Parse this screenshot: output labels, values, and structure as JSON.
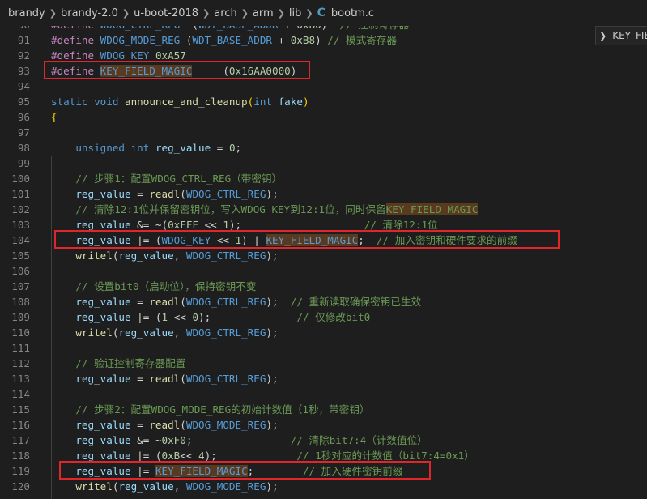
{
  "breadcrumb": {
    "segments": [
      "brandy",
      "brandy-2.0",
      "u-boot-2018",
      "arch",
      "arm",
      "lib"
    ],
    "file_icon": "C",
    "file_name": "bootm.c"
  },
  "outline": {
    "label": "KEY_FIE"
  },
  "highlight_color": "#e0262b",
  "lines": [
    {
      "n": "90",
      "t": [
        [
          "pp",
          "#define "
        ],
        [
          "mac",
          "WDOG_CTRL_REG"
        ],
        [
          "",
          "  ("
        ],
        [
          "mac",
          "WDT_BASE_ADDR"
        ],
        [
          "",
          " + "
        ],
        [
          "num",
          "0xB0"
        ],
        [
          "",
          ")  "
        ],
        [
          "cm",
          "// 控制寄存器"
        ]
      ]
    },
    {
      "n": "91",
      "t": [
        [
          "pp",
          "#define "
        ],
        [
          "mac",
          "WDOG_MODE_REG"
        ],
        [
          "",
          " ("
        ],
        [
          "mac",
          "WDT_BASE_ADDR"
        ],
        [
          "",
          " + "
        ],
        [
          "num",
          "0xB8"
        ],
        [
          "",
          ") "
        ],
        [
          "cm",
          "// 模式寄存器"
        ]
      ]
    },
    {
      "n": "92",
      "t": [
        [
          "pp",
          "#define "
        ],
        [
          "mac",
          "WDOG_KEY"
        ],
        [
          "",
          " "
        ],
        [
          "num",
          "0xA57"
        ]
      ]
    },
    {
      "n": "93",
      "t": [
        [
          "pp",
          "#define "
        ],
        [
          "mac hl",
          "KEY_FIELD_MAGIC"
        ],
        [
          "",
          "     ("
        ],
        [
          "num",
          "0x16AA0000"
        ],
        [
          "",
          ")"
        ]
      ]
    },
    {
      "n": "94",
      "t": []
    },
    {
      "n": "95",
      "t": [
        [
          "kw",
          "static "
        ],
        [
          "kw",
          "void "
        ],
        [
          "fn",
          "announce_and_cleanup"
        ],
        [
          "br",
          "("
        ],
        [
          "kw",
          "int "
        ],
        [
          "var",
          "fake"
        ],
        [
          "br",
          ")"
        ]
      ]
    },
    {
      "n": "96",
      "t": [
        [
          "br",
          "{"
        ]
      ]
    },
    {
      "n": "97",
      "t": []
    },
    {
      "n": "98",
      "t": [
        [
          "",
          "    "
        ],
        [
          "kw",
          "unsigned "
        ],
        [
          "kw",
          "int "
        ],
        [
          "var",
          "reg_value"
        ],
        [
          "",
          " = "
        ],
        [
          "num",
          "0"
        ],
        [
          "",
          ";"
        ]
      ]
    },
    {
      "n": "99",
      "t": []
    },
    {
      "n": "100",
      "t": [
        [
          "",
          "    "
        ],
        [
          "cm",
          "// 步骤1：配置WDOG_CTRL_REG（带密钥）"
        ]
      ]
    },
    {
      "n": "101",
      "t": [
        [
          "",
          "    "
        ],
        [
          "var",
          "reg_value"
        ],
        [
          "",
          " = "
        ],
        [
          "fn",
          "readl"
        ],
        [
          "",
          "("
        ],
        [
          "mac",
          "WDOG_CTRL_REG"
        ],
        [
          "",
          ");"
        ]
      ]
    },
    {
      "n": "102",
      "t": [
        [
          "",
          "    "
        ],
        [
          "cm",
          "// 清除12:1位并保留密钥位，写入WDOG_KEY到12:1位，同时保留"
        ],
        [
          "cm hl",
          "KEY_FIELD_MAGIC"
        ]
      ]
    },
    {
      "n": "103",
      "t": [
        [
          "",
          "    "
        ],
        [
          "var",
          "reg_value"
        ],
        [
          "",
          " &= ~("
        ],
        [
          "num",
          "0xFFF"
        ],
        [
          "",
          " << "
        ],
        [
          "num",
          "1"
        ],
        [
          "",
          ");                    "
        ],
        [
          "cm",
          "// 清除12:1位"
        ]
      ]
    },
    {
      "n": "104",
      "t": [
        [
          "",
          "    "
        ],
        [
          "var",
          "reg_value"
        ],
        [
          "",
          " |= ("
        ],
        [
          "mac",
          "WDOG_KEY"
        ],
        [
          "",
          " << "
        ],
        [
          "num",
          "1"
        ],
        [
          "",
          ") | "
        ],
        [
          "mac hl",
          "KEY_FIELD_MAGIC"
        ],
        [
          "",
          ";  "
        ],
        [
          "cm",
          "// 加入密钥和硬件要求的前缀"
        ]
      ]
    },
    {
      "n": "105",
      "t": [
        [
          "",
          "    "
        ],
        [
          "fn",
          "writel"
        ],
        [
          "",
          "("
        ],
        [
          "var",
          "reg_value"
        ],
        [
          "",
          ", "
        ],
        [
          "mac",
          "WDOG_CTRL_REG"
        ],
        [
          "",
          ");"
        ]
      ]
    },
    {
      "n": "106",
      "t": []
    },
    {
      "n": "107",
      "t": [
        [
          "",
          "    "
        ],
        [
          "cm",
          "// 设置bit0（启动位），保持密钥不变"
        ]
      ]
    },
    {
      "n": "108",
      "t": [
        [
          "",
          "    "
        ],
        [
          "var",
          "reg_value"
        ],
        [
          "",
          " = "
        ],
        [
          "fn",
          "readl"
        ],
        [
          "",
          "("
        ],
        [
          "mac",
          "WDOG_CTRL_REG"
        ],
        [
          "",
          ");  "
        ],
        [
          "cm",
          "// 重新读取确保密钥已生效"
        ]
      ]
    },
    {
      "n": "109",
      "t": [
        [
          "",
          "    "
        ],
        [
          "var",
          "reg_value"
        ],
        [
          "",
          " |= ("
        ],
        [
          "num",
          "1"
        ],
        [
          "",
          " << "
        ],
        [
          "num",
          "0"
        ],
        [
          "",
          ");              "
        ],
        [
          "cm",
          "// 仅修改bit0"
        ]
      ]
    },
    {
      "n": "110",
      "t": [
        [
          "",
          "    "
        ],
        [
          "fn",
          "writel"
        ],
        [
          "",
          "("
        ],
        [
          "var",
          "reg_value"
        ],
        [
          "",
          ", "
        ],
        [
          "mac",
          "WDOG_CTRL_REG"
        ],
        [
          "",
          ");"
        ]
      ]
    },
    {
      "n": "111",
      "t": []
    },
    {
      "n": "112",
      "t": [
        [
          "",
          "    "
        ],
        [
          "cm",
          "// 验证控制寄存器配置"
        ]
      ]
    },
    {
      "n": "113",
      "t": [
        [
          "",
          "    "
        ],
        [
          "var",
          "reg_value"
        ],
        [
          "",
          " = "
        ],
        [
          "fn",
          "readl"
        ],
        [
          "",
          "("
        ],
        [
          "mac",
          "WDOG_CTRL_REG"
        ],
        [
          "",
          ");"
        ]
      ]
    },
    {
      "n": "114",
      "t": []
    },
    {
      "n": "115",
      "t": [
        [
          "",
          "    "
        ],
        [
          "cm",
          "// 步骤2：配置WDOG_MODE_REG的初始计数值（1秒，带密钥）"
        ]
      ]
    },
    {
      "n": "116",
      "t": [
        [
          "",
          "    "
        ],
        [
          "var",
          "reg_value"
        ],
        [
          "",
          " = "
        ],
        [
          "fn",
          "readl"
        ],
        [
          "",
          "("
        ],
        [
          "mac",
          "WDOG_MODE_REG"
        ],
        [
          "",
          ");"
        ]
      ]
    },
    {
      "n": "117",
      "t": [
        [
          "",
          "    "
        ],
        [
          "var",
          "reg_value"
        ],
        [
          "",
          " &= ~"
        ],
        [
          "num",
          "0xF0"
        ],
        [
          "",
          ";                "
        ],
        [
          "cm",
          "// 清除bit7:4（计数值位）"
        ]
      ]
    },
    {
      "n": "118",
      "t": [
        [
          "",
          "    "
        ],
        [
          "var",
          "reg_value"
        ],
        [
          "",
          " |= ("
        ],
        [
          "num",
          "0xB"
        ],
        [
          "",
          "<< "
        ],
        [
          "num",
          "4"
        ],
        [
          "",
          ");             "
        ],
        [
          "cm",
          "// 1秒对应的计数值（bit7:4=0x1）"
        ]
      ]
    },
    {
      "n": "119",
      "t": [
        [
          "",
          "    "
        ],
        [
          "var",
          "reg_value"
        ],
        [
          "",
          " |= "
        ],
        [
          "mac hl",
          "KEY_FIELD_MAGIC"
        ],
        [
          "",
          ";        "
        ],
        [
          "cm",
          "// 加入硬件密钥前缀"
        ]
      ]
    },
    {
      "n": "120",
      "t": [
        [
          "",
          "    "
        ],
        [
          "fn",
          "writel"
        ],
        [
          "",
          "("
        ],
        [
          "var",
          "reg_value"
        ],
        [
          "",
          ", "
        ],
        [
          "mac",
          "WDOG_MODE_REG"
        ],
        [
          "",
          ");"
        ]
      ]
    }
  ]
}
